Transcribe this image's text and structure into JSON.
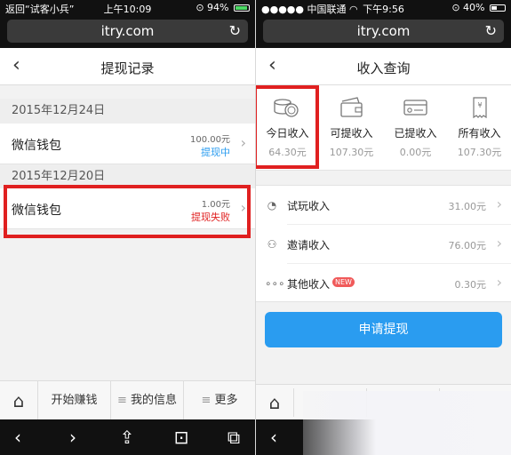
{
  "left": {
    "status": {
      "carrier": "返回“试客小兵”",
      "time": "上午10:09",
      "battery": "94%",
      "battery_fraction": 0.94
    },
    "url": "itry.com",
    "nav": {
      "title": "提现记录"
    },
    "groups": [
      {
        "date": "2015年12月24日",
        "records": [
          {
            "title": "微信钱包",
            "amount": "100.00元",
            "status": "提现中",
            "status_color": "#2a9cf0"
          }
        ]
      },
      {
        "date": "2015年12月20日",
        "records": [
          {
            "title": "微信钱包",
            "amount": "1.00元",
            "status": "提现失败",
            "status_color": "#e02020"
          }
        ]
      }
    ],
    "tabs": {
      "earn": "开始赚钱",
      "info": "我的信息",
      "more": "更多"
    }
  },
  "right": {
    "status": {
      "carrier": "●●●●● 中国联通",
      "time": "下午9:56",
      "battery": "40%",
      "battery_fraction": 0.4
    },
    "url": "itry.com",
    "nav": {
      "title": "收入查询"
    },
    "stats": [
      {
        "label": "今日收入",
        "value": "64.30元",
        "icon": "coins-icon"
      },
      {
        "label": "可提收入",
        "value": "107.30元",
        "icon": "wallet-icon"
      },
      {
        "label": "已提收入",
        "value": "0.00元",
        "icon": "card-icon"
      },
      {
        "label": "所有收入",
        "value": "107.30元",
        "icon": "receipt-icon"
      }
    ],
    "income": [
      {
        "label": "试玩收入",
        "value": "31.00元",
        "icon": "palette-icon"
      },
      {
        "label": "邀请收入",
        "value": "76.00元",
        "icon": "add-user-icon"
      },
      {
        "label": "其他收入",
        "value": "0.30元",
        "icon": "dots-icon",
        "badge": "NEW"
      }
    ],
    "apply_label": "申请提现"
  },
  "colors": {
    "accent": "#2a9cf0",
    "highlight": "#e02020",
    "badge": "#f05a5a"
  }
}
